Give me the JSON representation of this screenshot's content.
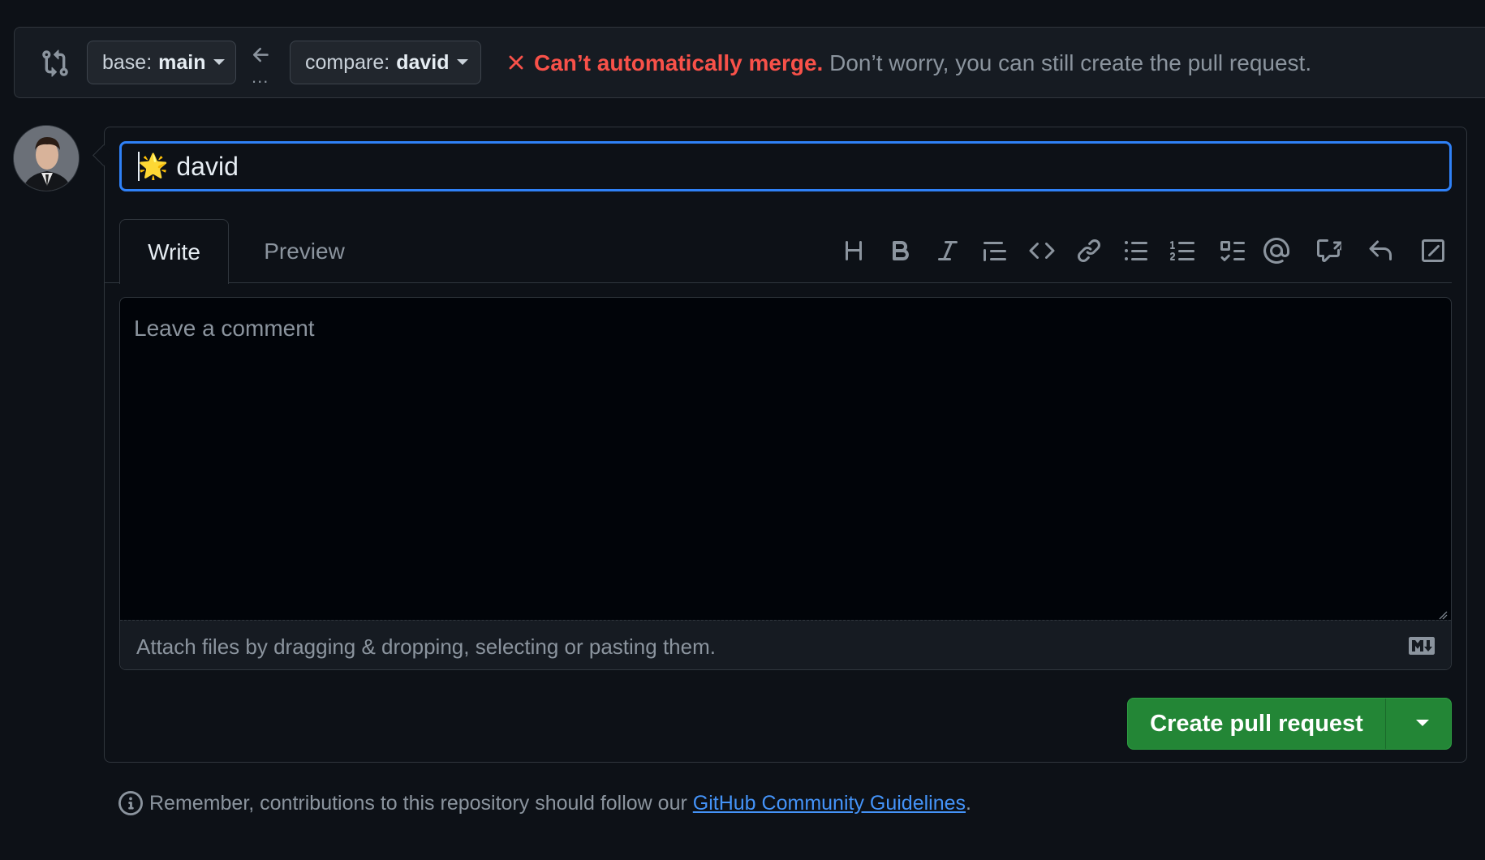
{
  "compare_bar": {
    "base_label": "base:",
    "base_value": "main",
    "compare_label": "compare:",
    "compare_value": "david",
    "dots": "...",
    "merge_status": "Can’t automatically merge.",
    "merge_detail": "Don’t worry, you can still create the pull request."
  },
  "form": {
    "title_value": "david",
    "title_emoji": "🌟",
    "tabs": [
      {
        "label": "Write"
      },
      {
        "label": "Preview"
      }
    ],
    "toolbar_icons": [
      "heading-icon",
      "bold-icon",
      "italic-icon",
      "quote-icon",
      "code-icon",
      "link-icon",
      "unordered-list-icon",
      "ordered-list-icon",
      "task-list-icon",
      "mention-icon",
      "reference-icon",
      "reply-icon",
      "slash-command-icon"
    ],
    "comment_placeholder": "Leave a comment",
    "attach_text": "Attach files by dragging & dropping, selecting or pasting them.",
    "create_label": "Create pull request"
  },
  "footer": {
    "note_prefix": "Remember, contributions to this repository should follow our ",
    "link_text": "GitHub Community Guidelines",
    "note_suffix": "."
  },
  "colors": {
    "background": "#0d1117",
    "accent_blue": "#2f81f7",
    "error_red": "#f85149",
    "primary_green": "#238636"
  }
}
